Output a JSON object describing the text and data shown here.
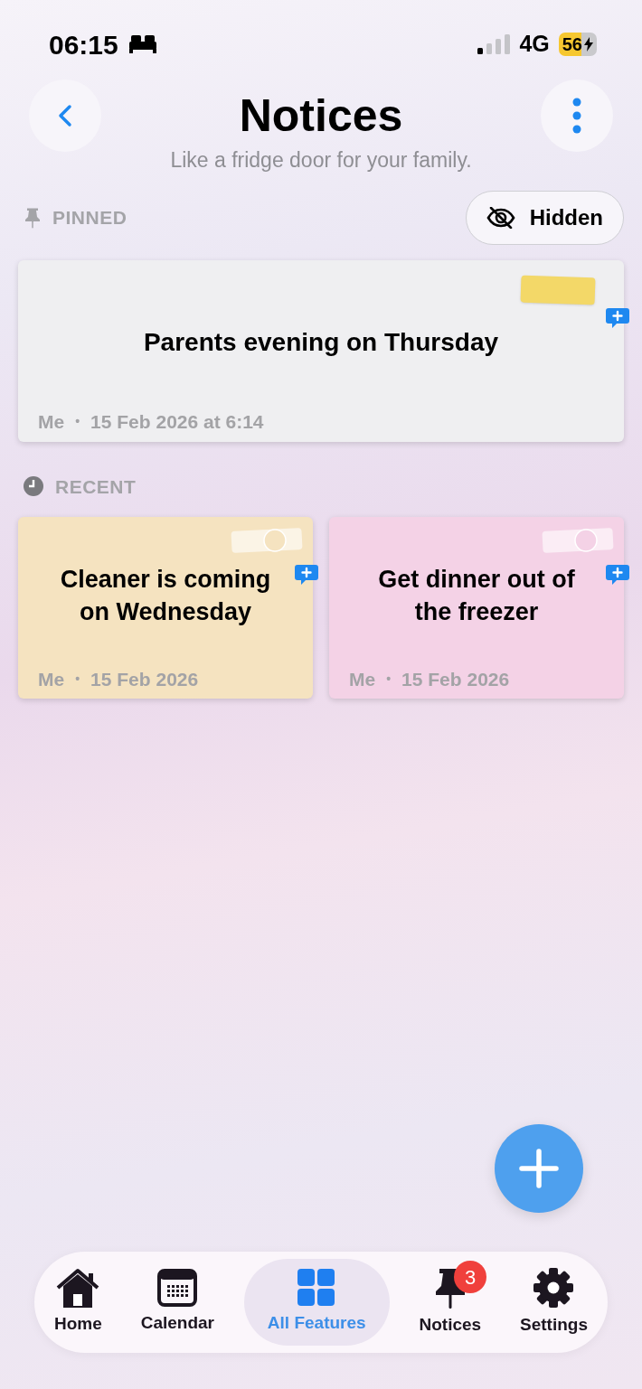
{
  "status_bar": {
    "time": "06:15",
    "network": "4G",
    "battery": "56"
  },
  "header": {
    "title": "Notices",
    "subtitle": "Like a fridge door for your family."
  },
  "pinned": {
    "label": "PINNED",
    "hidden_button": "Hidden",
    "notes": [
      {
        "text": "Parents evening on Thursday",
        "author": "Me",
        "separator": "•",
        "date": "15 Feb 2026 at 6:14",
        "color": "#efeff1",
        "kind": "tape"
      }
    ]
  },
  "recent": {
    "label": "RECENT",
    "notes": [
      {
        "text": "Cleaner is coming on Wednesday",
        "author": "Me",
        "separator": "•",
        "date": "15 Feb 2026",
        "color": "#f5e3c0",
        "kind": "magnet"
      },
      {
        "text": "Get dinner out of the freezer",
        "author": "Me",
        "separator": "•",
        "date": "15 Feb 2026",
        "color": "#f4d2e6",
        "kind": "magnet"
      }
    ]
  },
  "tab_bar": [
    {
      "label": "Home",
      "selected": false
    },
    {
      "label": "Calendar",
      "selected": false
    },
    {
      "label": "All Features",
      "selected": true
    },
    {
      "label": "Notices",
      "selected": false,
      "badge": "3"
    },
    {
      "label": "Settings",
      "selected": false
    }
  ]
}
